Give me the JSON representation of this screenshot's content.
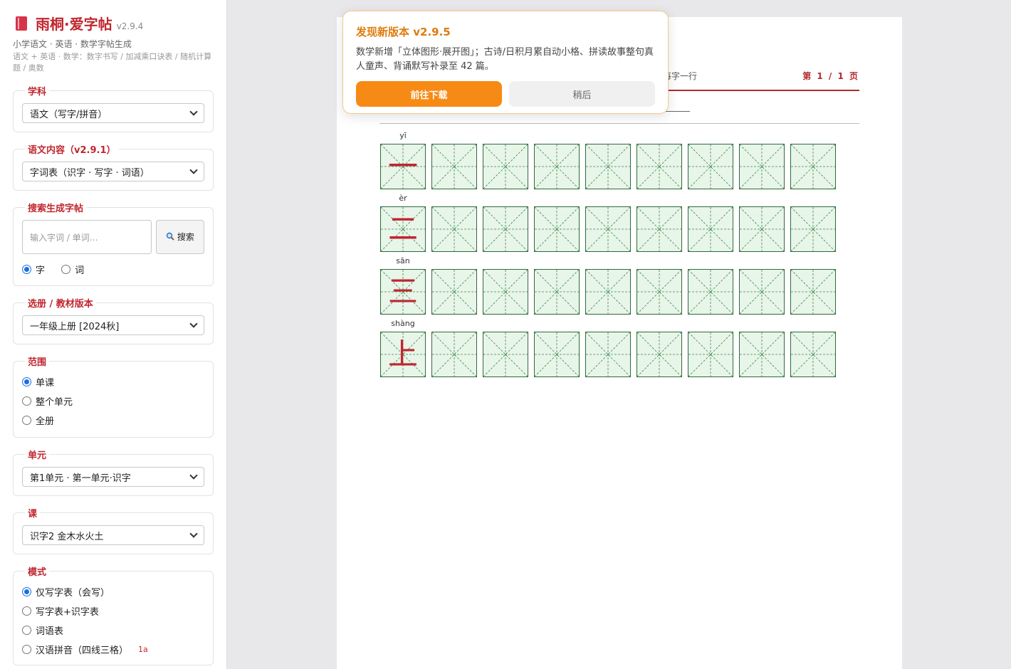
{
  "app": {
    "title": "雨桐·爱字帖",
    "version": "v2.9.4",
    "tagline": "小学语文 · 英语 · 数学字帖生成",
    "subtagline": "语文 + 英语 · 数学：数字书写 / 加减乘口诀表 / 随机计算题 / 奥数",
    "brand_color": "#c0262f"
  },
  "sidebar": {
    "subject": {
      "legend": "学科",
      "value": "语文（写字/拼音）"
    },
    "content": {
      "legend": "语文内容（v2.9.1）",
      "value": "字词表（识字 · 写字 · 词语）"
    },
    "search": {
      "legend": "搜索生成字帖",
      "placeholder": "输入字词 / 单词…",
      "button_label": "搜索",
      "options": [
        {
          "label": "字",
          "checked": true
        },
        {
          "label": "词",
          "checked": false
        }
      ]
    },
    "edition": {
      "legend": "选册 / 教材版本",
      "value": "一年级上册 [2024秋]"
    },
    "scope": {
      "legend": "范围",
      "options": [
        {
          "label": "单课",
          "checked": true
        },
        {
          "label": "整个单元",
          "checked": false
        },
        {
          "label": "全册",
          "checked": false
        }
      ]
    },
    "unit": {
      "legend": "单元",
      "value": "第1单元 · 第一单元·识字"
    },
    "lesson": {
      "legend": "课",
      "value": "识字2 金木水火土"
    },
    "mode": {
      "legend": "模式",
      "options": [
        {
          "label": "仅写字表（会写）",
          "checked": true
        },
        {
          "label": "写字表+识字表",
          "checked": false
        },
        {
          "label": "词语表",
          "checked": false
        },
        {
          "label": "汉语拼音（四线三格）",
          "checked": false,
          "tag": "1a"
        }
      ]
    }
  },
  "paper": {
    "header_note": "每字一行",
    "page_indicator": "第 1 / 1 页",
    "cells_per_row": 9,
    "cell_color": "#e8f5e9",
    "rows": [
      {
        "pinyin": "yī",
        "char": "一"
      },
      {
        "pinyin": "èr",
        "char": "二"
      },
      {
        "pinyin": "sān",
        "char": "三"
      },
      {
        "pinyin": "shàng",
        "char": "上"
      }
    ]
  },
  "popup": {
    "title": "发现新版本 v2.9.5",
    "body": "数学新增「立体图形·展开图」；古诗/日积月累自动小格、拼读故事整句真人童声、背诵默写补录至 42 篇。",
    "primary_label": "前往下载",
    "secondary_label": "稍后",
    "accent_color": "#f78a14"
  }
}
